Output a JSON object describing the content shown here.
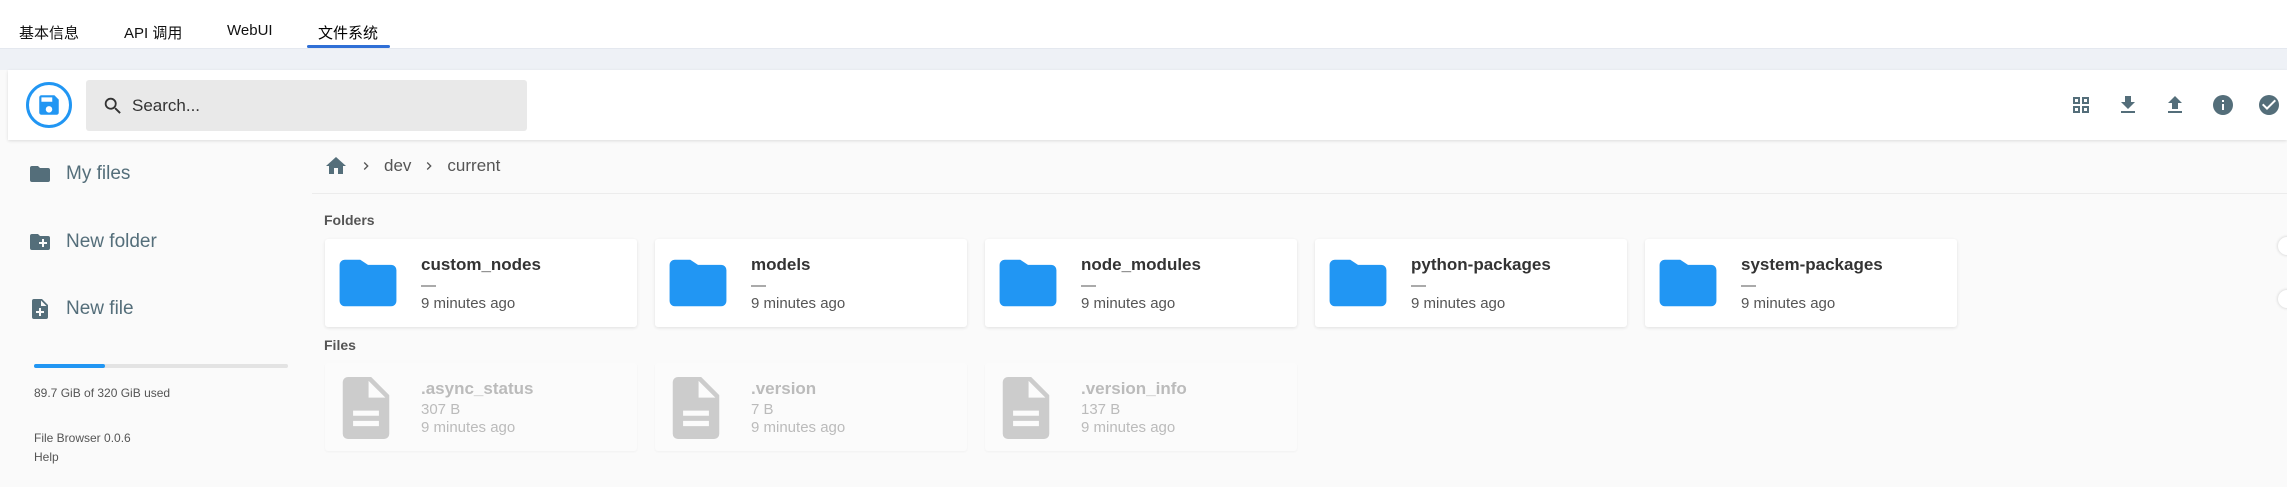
{
  "top_tabs": [
    {
      "label": "基本信息"
    },
    {
      "label": "API 调用"
    },
    {
      "label": "WebUI"
    },
    {
      "label": "文件系统"
    }
  ],
  "search": {
    "placeholder": "Search..."
  },
  "toolbar_icons": [
    "grid-view-icon",
    "download-icon",
    "upload-icon",
    "info-icon",
    "select-all-icon"
  ],
  "sidebar": {
    "items": [
      {
        "label": "My files"
      },
      {
        "label": "New folder"
      },
      {
        "label": "New file"
      }
    ],
    "usage": {
      "text": "89.7 GiB of 320 GiB used",
      "fraction": 0.28
    },
    "version": "File Browser 0.0.6",
    "help": "Help"
  },
  "breadcrumb": [
    "dev",
    "current"
  ],
  "folders_title": "Folders",
  "files_title": "Files",
  "folders": [
    {
      "name": "custom_nodes",
      "size": "—",
      "modified": "9 minutes ago"
    },
    {
      "name": "models",
      "size": "—",
      "modified": "9 minutes ago"
    },
    {
      "name": "node_modules",
      "size": "—",
      "modified": "9 minutes ago"
    },
    {
      "name": "python-packages",
      "size": "—",
      "modified": "9 minutes ago"
    },
    {
      "name": "system-packages",
      "size": "—",
      "modified": "9 minutes ago"
    }
  ],
  "files": [
    {
      "name": ".async_status",
      "size": "307 B",
      "modified": "9 minutes ago"
    },
    {
      "name": ".version",
      "size": "7 B",
      "modified": "9 minutes ago"
    },
    {
      "name": ".version_info",
      "size": "137 B",
      "modified": "9 minutes ago"
    }
  ],
  "colors": {
    "accent": "#2196f3",
    "folder": "#2196f3",
    "file": "#cccccc",
    "icon_gray": "#546e7a"
  }
}
